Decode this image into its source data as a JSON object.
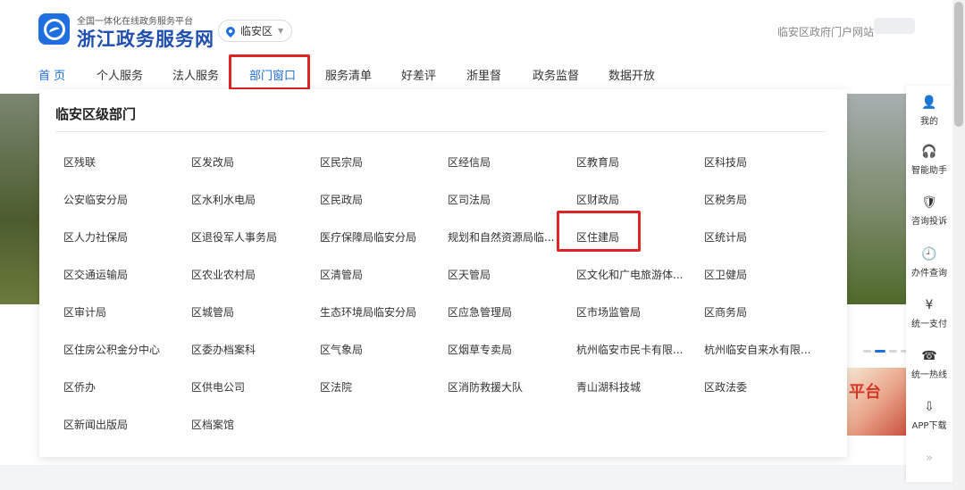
{
  "header": {
    "site_subtitle": "全国一体化在线政务服务平台",
    "site_title": "浙江政务服务网",
    "region": "临安区",
    "portal_link": "临安区政府门户网站"
  },
  "nav": {
    "items": [
      "首 页",
      "个人服务",
      "法人服务",
      "部门窗口",
      "服务清单",
      "好差评",
      "浙里督",
      "政务监督",
      "数据开放"
    ]
  },
  "panel": {
    "title": "临安区级部门",
    "depts": [
      [
        "区残联",
        "区发改局",
        "区民宗局",
        "区经信局",
        "区教育局",
        "区科技局"
      ],
      [
        "公安临安分局",
        "区水利水电局",
        "区民政局",
        "区司法局",
        "区财政局",
        "区税务局"
      ],
      [
        "区人力社保局",
        "区退役军人事务局",
        "医疗保障局临安分局",
        "规划和自然资源局临...",
        "区住建局",
        "区统计局"
      ],
      [
        "区交通运输局",
        "区农业农村局",
        "区清管局",
        "区天管局",
        "区文化和广电旅游体...",
        "区卫健局"
      ],
      [
        "区审计局",
        "区城管局",
        "生态环境局临安分局",
        "区应急管理局",
        "区市场监管局",
        "区商务局"
      ],
      [
        "区住房公积金分中心",
        "区委办档案科",
        "区气象局",
        "区烟草专卖局",
        "杭州临安市民卡有限...",
        "杭州临安自来水有限..."
      ],
      [
        "区侨办",
        "区供电公司",
        "区法院",
        "区消防救援大队",
        "青山湖科技城",
        "区政法委"
      ],
      [
        "区新闻出版局",
        "区档案馆"
      ]
    ]
  },
  "banner": {
    "text": "平台"
  },
  "toolbar": {
    "items": [
      {
        "label": "我的",
        "icon": "user-icon"
      },
      {
        "label": "智能助手",
        "icon": "headset-icon"
      },
      {
        "label": "咨询投诉",
        "icon": "shield-icon"
      },
      {
        "label": "办件查询",
        "icon": "clock-icon"
      },
      {
        "label": "统一支付",
        "icon": "yen-icon"
      },
      {
        "label": "统一热线",
        "icon": "phone-icon"
      },
      {
        "label": "APP下载",
        "icon": "download-icon"
      }
    ]
  },
  "colors": {
    "accent": "#1f6fe0",
    "highlight_box": "#e02323"
  }
}
